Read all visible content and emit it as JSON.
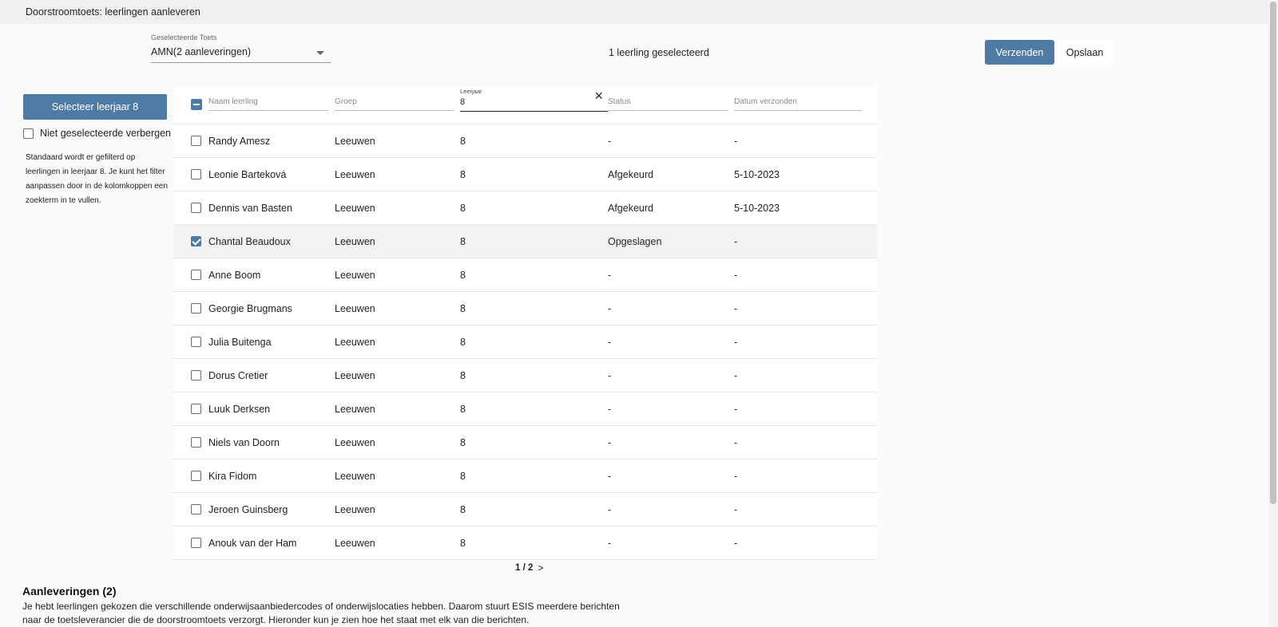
{
  "header": {
    "title": "Doorstroomtoets: leerlingen aanleveren"
  },
  "toolbar": {
    "test_select_label": "Geselecteerde Toets",
    "test_select_value": "AMN(2 aanleveringen)",
    "selected_count": "1 leerling geselecteerd",
    "send_label": "Verzenden",
    "save_label": "Opslaan"
  },
  "sidebar": {
    "select_year_label": "Selecteer leerjaar 8",
    "hide_unselected_label": "Niet geselecteerde verbergen",
    "help_text": "Standaard wordt er gefilterd op leerlingen in leerjaar 8. Je kunt het filter aanpassen door in de kolomkoppen een zoekterm in te vullen."
  },
  "table": {
    "columns": {
      "name": "Naam leerling",
      "group": "Groep",
      "year": "Leerjaar",
      "status": "Status",
      "date": "Datum verzonden"
    },
    "year_filter_value": "8",
    "clear_icon": "close-icon",
    "rows": [
      {
        "name": "Randy Amesz",
        "group": "Leeuwen",
        "year": "8",
        "status": "-",
        "date": "-",
        "checked": false
      },
      {
        "name": "Leonie Barteková",
        "group": "Leeuwen",
        "year": "8",
        "status": "Afgekeurd",
        "date": "5-10-2023",
        "checked": false
      },
      {
        "name": "Dennis van Basten",
        "group": "Leeuwen",
        "year": "8",
        "status": "Afgekeurd",
        "date": "5-10-2023",
        "checked": false
      },
      {
        "name": "Chantal Beaudoux",
        "group": "Leeuwen",
        "year": "8",
        "status": "Opgeslagen",
        "date": "-",
        "checked": true
      },
      {
        "name": "Anne Boom",
        "group": "Leeuwen",
        "year": "8",
        "status": "-",
        "date": "-",
        "checked": false
      },
      {
        "name": "Georgie Brugmans",
        "group": "Leeuwen",
        "year": "8",
        "status": "-",
        "date": "-",
        "checked": false
      },
      {
        "name": "Julia Buitenga",
        "group": "Leeuwen",
        "year": "8",
        "status": "-",
        "date": "-",
        "checked": false
      },
      {
        "name": "Dorus Cretier",
        "group": "Leeuwen",
        "year": "8",
        "status": "-",
        "date": "-",
        "checked": false
      },
      {
        "name": "Luuk Derksen",
        "group": "Leeuwen",
        "year": "8",
        "status": "-",
        "date": "-",
        "checked": false
      },
      {
        "name": "Niels van Doorn",
        "group": "Leeuwen",
        "year": "8",
        "status": "-",
        "date": "-",
        "checked": false
      },
      {
        "name": "Kira Fidom",
        "group": "Leeuwen",
        "year": "8",
        "status": "-",
        "date": "-",
        "checked": false
      },
      {
        "name": "Jeroen Guinsberg",
        "group": "Leeuwen",
        "year": "8",
        "status": "-",
        "date": "-",
        "checked": false
      },
      {
        "name": "Anouk van der Ham",
        "group": "Leeuwen",
        "year": "8",
        "status": "-",
        "date": "-",
        "checked": false
      }
    ]
  },
  "pagination": {
    "current": "1 / 2",
    "next": ">"
  },
  "deliveries": {
    "title": "Aanleveringen (2)",
    "text": "Je hebt leerlingen gekozen die verschillende onderwijsaanbiedercodes of onderwijslocaties hebben. Daarom stuurt ESIS meerdere berichten naar de toetsleverancier die de doorstroomtoets verzorgt. Hieronder kun je zien hoe het staat met elk van die berichten."
  },
  "colors": {
    "accent": "#4f7aa3",
    "background": "#fafafa",
    "row_selected": "#f2f3f5"
  }
}
